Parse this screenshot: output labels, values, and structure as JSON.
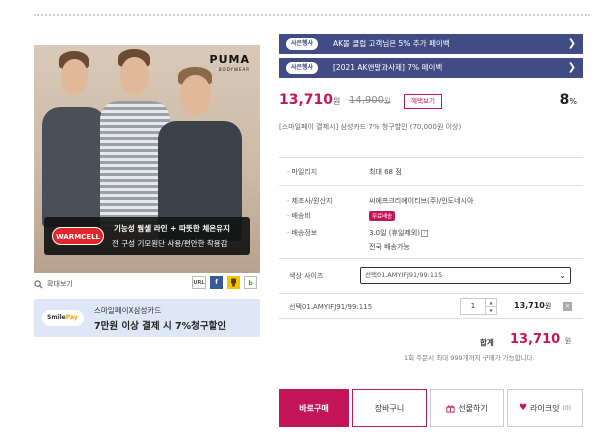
{
  "colors": {
    "accent": "#c5155a",
    "coupon_bg": "#414c87",
    "banner_bg": "#dfe6f5"
  },
  "product_image": {
    "brand_logo": "PUMA",
    "brand_sub": "BODYWEAR",
    "badge": "WARMCELL",
    "banner_line1": "기능성 웜셀 라인 + 따뜻한 체온유지",
    "banner_line2": "전 구성 기모원단 사용/편안한 착용감"
  },
  "zoom_label": "확대보기",
  "share": {
    "url": "URL",
    "facebook": "f",
    "kakaostory": "ks",
    "band": "b"
  },
  "smile_banner": {
    "logo_main": "Smile",
    "logo_accent": "Pay",
    "line1": "스마일페이X삼성카드",
    "line2": "7만원 이상 결제 시 7%청구할인"
  },
  "coupons": [
    {
      "tag": "사은행사",
      "text": "AK몰 클럽 고객님은 5% 추가 페이백"
    },
    {
      "tag": "사은행사",
      "text": "[2021 AK앤말과사제] 7% 페이백"
    }
  ],
  "price": {
    "sale": "13,710",
    "sale_unit": "원",
    "original": "14,900",
    "original_unit": "원",
    "benefit_button": "혜택보기",
    "discount": "8",
    "discount_unit": "%"
  },
  "promo_note": "[스마일페이 결제시] 삼성카드 7% 청구할인 (70,000원 이상)",
  "info": {
    "mileage_label": "마일리지",
    "mileage_value": "최대 68 점",
    "maker_label": "제조사/원산지",
    "maker_value": "씨에프크리에이티브(주)/인도네시아",
    "shipping_fee_label": "배송비",
    "shipping_fee_value": "무료배송",
    "shipping_info_label": "배송정보",
    "shipping_info_value1": "3.0일 (휴일제외)",
    "shipping_info_value2": "전국 배송가능"
  },
  "option": {
    "label": "색상 사이즈",
    "selected": "선택01.AMYIFJ91/99:115"
  },
  "selected_item": {
    "name": "선택01.AMYIFJ91/99:115",
    "quantity": "1",
    "price": "13,710",
    "price_unit": "원"
  },
  "total": {
    "label": "합계",
    "amount": "13,710",
    "unit": "원",
    "limit_note": "1회 주문시 최대 999개까지 구매가 가능합니다."
  },
  "actions": {
    "buy": "바로구매",
    "cart": "장바구니",
    "gift": "선물하기",
    "like": "라이크잇",
    "like_count": "(0)"
  }
}
